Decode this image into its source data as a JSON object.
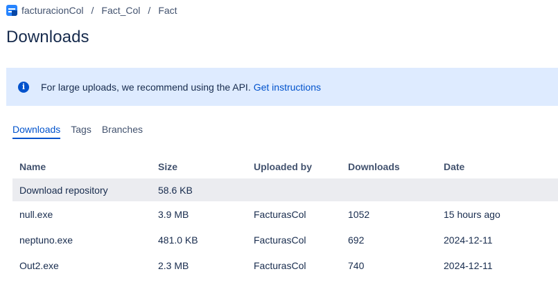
{
  "breadcrumb": {
    "workspace": "facturacionCol",
    "separator": "/",
    "project": "Fact_Col",
    "repo": "Fact",
    "avatar_icon": "repository-avatar-icon"
  },
  "page": {
    "title": "Downloads"
  },
  "banner": {
    "icon": "info-icon",
    "icon_glyph": "i",
    "message": "For large uploads, we recommend using the API.",
    "link": "Get instructions",
    "background": "#deebff",
    "accent": "#0052cc"
  },
  "tabs": [
    {
      "label": "Downloads",
      "active": true
    },
    {
      "label": "Tags",
      "active": false
    },
    {
      "label": "Branches",
      "active": false
    }
  ],
  "table": {
    "headers": [
      "Name",
      "Size",
      "Uploaded by",
      "Downloads",
      "Date"
    ],
    "repo_row": {
      "name": "Download repository",
      "size": "58.6 KB"
    },
    "rows": [
      {
        "name": "null.exe",
        "size": "3.9 MB",
        "uploaded_by": "FacturasCol",
        "downloads": "1052",
        "date": "15 hours ago"
      },
      {
        "name": "neptuno.exe",
        "size": "481.0 KB",
        "uploaded_by": "FacturasCol",
        "downloads": "692",
        "date": "2024-12-11"
      },
      {
        "name": "Out2.exe",
        "size": "2.3 MB",
        "uploaded_by": "FacturasCol",
        "downloads": "740",
        "date": "2024-12-11"
      }
    ]
  }
}
